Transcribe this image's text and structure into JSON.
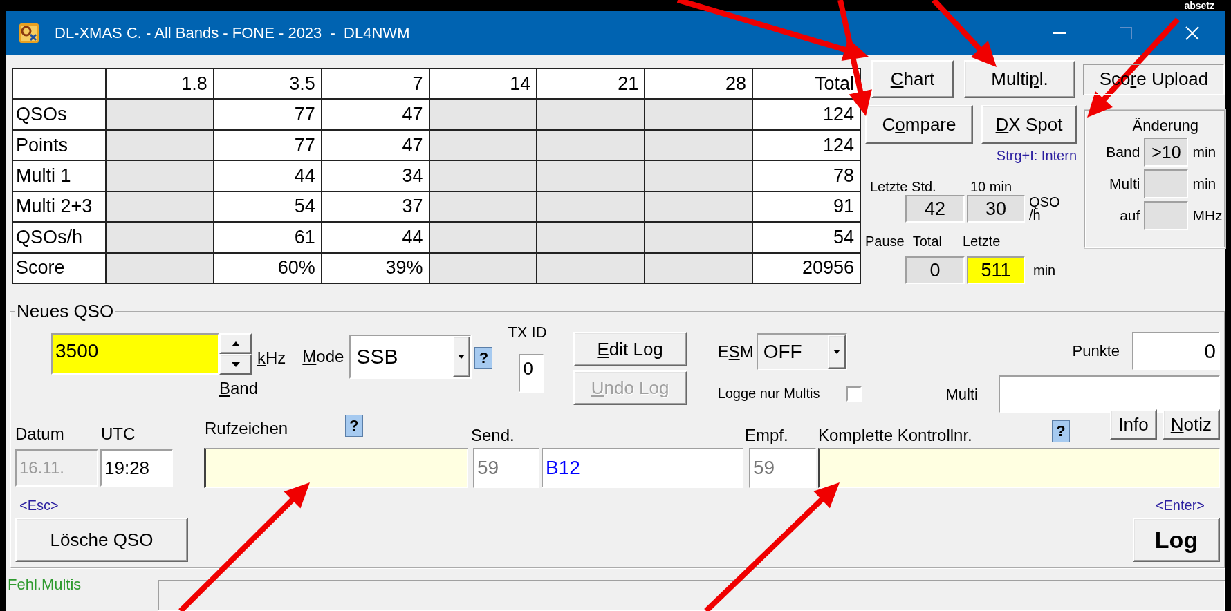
{
  "caption": "absetz",
  "window": {
    "title": "DL-XMAS C. - All Bands - FONE - 2023  -  DL4NWM"
  },
  "score_table": {
    "columns": [
      {
        "label": "1.8",
        "active": false
      },
      {
        "label": "3.5",
        "active": true
      },
      {
        "label": "7",
        "active": true
      },
      {
        "label": "14",
        "active": false
      },
      {
        "label": "21",
        "active": false
      },
      {
        "label": "28",
        "active": false
      },
      {
        "label": "Total",
        "active": true
      }
    ],
    "rows": [
      {
        "label": "QSOs",
        "cells": [
          null,
          "77",
          "47",
          null,
          null,
          null,
          "124"
        ]
      },
      {
        "label": "Points",
        "cells": [
          null,
          "77",
          "47",
          null,
          null,
          null,
          "124"
        ]
      },
      {
        "label": "Multi 1",
        "cells": [
          null,
          "44",
          "34",
          null,
          null,
          null,
          "78"
        ]
      },
      {
        "label": "Multi 2+3",
        "cells": [
          null,
          "54",
          "37",
          null,
          null,
          null,
          "91"
        ]
      },
      {
        "label": "QSOs/h",
        "cells": [
          null,
          "61",
          "44",
          null,
          null,
          null,
          "54"
        ]
      },
      {
        "label": "Score",
        "cells": [
          null,
          "60%",
          "39%",
          null,
          null,
          null,
          "20956"
        ]
      }
    ]
  },
  "tools": {
    "top_buttons": [
      {
        "label": [
          {
            "text": "C",
            "underline": true
          },
          {
            "text": "hart",
            "underline": false
          }
        ]
      },
      {
        "label": [
          {
            "text": "Multi",
            "underline": false
          },
          {
            "text": "p",
            "underline": true
          },
          {
            "text": "l.",
            "underline": false
          }
        ]
      }
    ],
    "score_upload": {
      "label": [
        {
          "text": "Sco",
          "underline": false
        },
        {
          "text": "r",
          "underline": true
        },
        {
          "text": "e Upload",
          "underline": false
        }
      ]
    },
    "buttons": [
      {
        "label": [
          {
            "text": "C",
            "underline": false
          },
          {
            "text": "o",
            "underline": true
          },
          {
            "text": "mpare",
            "underline": false
          }
        ]
      },
      {
        "label": [
          {
            "text": "D",
            "underline": true
          },
          {
            "text": "X Spot",
            "underline": false
          }
        ]
      }
    ],
    "hint": "Strg+I: Intern"
  },
  "rates": {
    "last_hour_label": "Letzte Std.",
    "ten_min_label": "10 min",
    "last_hour": "42",
    "ten_min": "30",
    "unit_lines": [
      "QSO",
      "/h"
    ]
  },
  "pause": {
    "label": "Pause",
    "total_label": "Total",
    "last_label": "Letzte",
    "total": "0",
    "last": "511",
    "last_highlighted": true,
    "unit": "min"
  },
  "change": {
    "title": "Änderung",
    "rows": [
      {
        "label": "Band",
        "value": ">10",
        "unit": "min"
      },
      {
        "label": "Multi",
        "unit": "min"
      },
      {
        "label": "auf",
        "unit": "MHz"
      }
    ]
  },
  "new_qso": {
    "title": "Neues QSO",
    "frequency": {
      "value": "3500",
      "unit": [
        {
          "text": "k",
          "underline": true
        },
        {
          "text": "Hz",
          "underline": false
        }
      ],
      "band": [
        {
          "text": "B",
          "underline": true
        },
        {
          "text": "and",
          "underline": false
        }
      ]
    },
    "mode": {
      "label": [
        {
          "text": "M",
          "underline": true
        },
        {
          "text": "ode",
          "underline": false
        }
      ],
      "value": "SSB",
      "help": "?"
    },
    "tx_id": {
      "label": "TX ID",
      "value": "0"
    },
    "log_buttons": [
      {
        "label": [
          {
            "text": "E",
            "underline": true
          },
          {
            "text": "dit Log",
            "underline": false
          }
        ],
        "disabled": false
      },
      {
        "label": [
          {
            "text": "U",
            "underline": true
          },
          {
            "text": "ndo Log",
            "underline": false
          }
        ],
        "disabled": true
      }
    ],
    "esm": {
      "label": [
        {
          "text": "E",
          "underline": false
        },
        {
          "text": "S",
          "underline": true
        },
        {
          "text": "M",
          "underline": false
        }
      ],
      "value": "OFF"
    },
    "log_only_multis": {
      "label": "Logge nur Multis",
      "checked": false
    },
    "points": {
      "label": "Punkte",
      "value": "0"
    },
    "multi": {
      "label": "Multi"
    },
    "date": {
      "label": "Datum",
      "value": "16.11.",
      "disabled": true
    },
    "utc": {
      "label": "UTC",
      "value": "19:28"
    },
    "call": {
      "label": "Rufzeichen",
      "help": "?"
    },
    "sent": {
      "label": "Send.",
      "rst": "59",
      "exchange": "B12"
    },
    "received": {
      "label": "Empf.",
      "rst": "59"
    },
    "control": {
      "label": "Komplette Kontrollnr.",
      "help": "?"
    },
    "side_buttons": [
      {
        "label": [
          {
            "text": "Info",
            "underline": false
          }
        ]
      },
      {
        "label": [
          {
            "text": "N",
            "underline": true
          },
          {
            "text": "otiz",
            "underline": false
          }
        ]
      }
    ],
    "esc_hint": "<Esc>",
    "clear_button": "Lösche QSO",
    "enter_hint": "<Enter>",
    "log_button": "Log"
  },
  "status": {
    "label": "Fehl.Multis"
  }
}
